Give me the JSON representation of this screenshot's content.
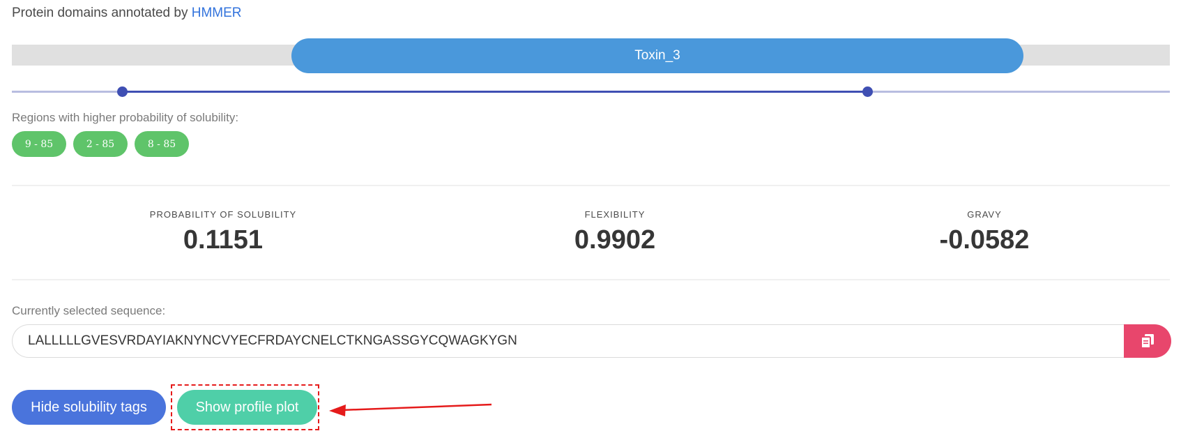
{
  "domains": {
    "heading_prefix": "Protein domains annotated by",
    "heading_link": "HMMER",
    "pills": [
      {
        "label": "Toxin_3"
      }
    ]
  },
  "solubility_regions": {
    "label": "Regions with higher probability of solubility:",
    "tags": [
      "9 - 85",
      "2 - 85",
      "8 - 85"
    ]
  },
  "stats": [
    {
      "label": "PROBABILITY OF SOLUBILITY",
      "value": "0.1151"
    },
    {
      "label": "FLEXIBILITY",
      "value": "0.9902"
    },
    {
      "label": "GRAVY",
      "value": "-0.0582"
    }
  ],
  "sequence": {
    "label": "Currently selected sequence:",
    "value": "LALLLLLGVESVRDAYIAKNYNCVYECFRDAYCNELCTKNGASSGYCQWAGKYGN"
  },
  "actions": {
    "hide_tags_label": "Hide solubility tags",
    "show_plot_label": "Show profile plot"
  },
  "colors": {
    "domain_pill": "#4a98db",
    "tag": "#5fc46a",
    "copy_button": "#e8466c",
    "hide_button": "#4a74dc",
    "plot_button": "#4fcfa8",
    "annotation": "#e51b1b"
  },
  "icons": {
    "copy": "copy-icon",
    "arrow": "arrow-left-icon"
  }
}
